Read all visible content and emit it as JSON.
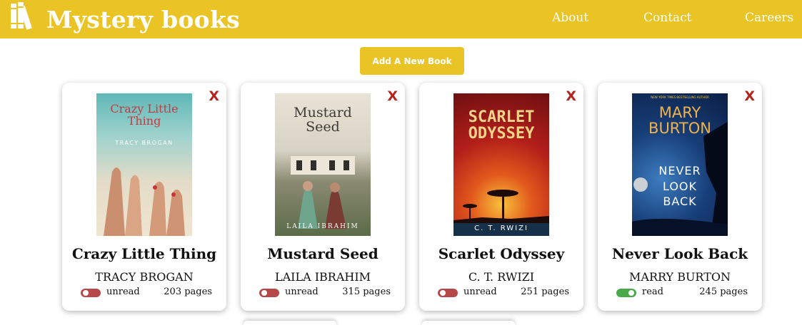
{
  "header": {
    "brand": "Mystery books",
    "nav": [
      "About",
      "Contact",
      "Careers"
    ]
  },
  "actions": {
    "add_book": "Add A New Book"
  },
  "colors": {
    "accent": "#eac424",
    "delete": "#b3241f",
    "unread_toggle": "#b54848",
    "read_toggle": "#48a84a"
  },
  "books": [
    {
      "title": "Crazy Little Thing",
      "author": "TRACY BROGAN",
      "status": "unread",
      "read": false,
      "pages": "203 pages",
      "delete_label": "X",
      "cover_title": "Crazy Little Thing",
      "cover_author": "TRACY BROGAN"
    },
    {
      "title": "Mustard Seed",
      "author": "LAILA IBRAHIM",
      "status": "unread",
      "read": false,
      "pages": "315 pages",
      "delete_label": "X",
      "cover_title": "Mustard Seed",
      "cover_author": "LAILA IBRAHIM"
    },
    {
      "title": "Scarlet Odyssey",
      "author": "C. T. RWIZI",
      "status": "unread",
      "read": false,
      "pages": "251 pages",
      "delete_label": "X",
      "cover_title": "SCARLET ODYSSEY",
      "cover_author": "C. T. RWIZI"
    },
    {
      "title": "Never Look Back",
      "author": "MARRY BURTON",
      "status": "read",
      "read": true,
      "pages": "245 pages",
      "delete_label": "X",
      "cover_title": "NEVER LOOK BACK",
      "cover_author": "MARY BURTON",
      "cover_tagline": "NEW YORK TIMES BESTSELLING AUTHOR"
    }
  ]
}
